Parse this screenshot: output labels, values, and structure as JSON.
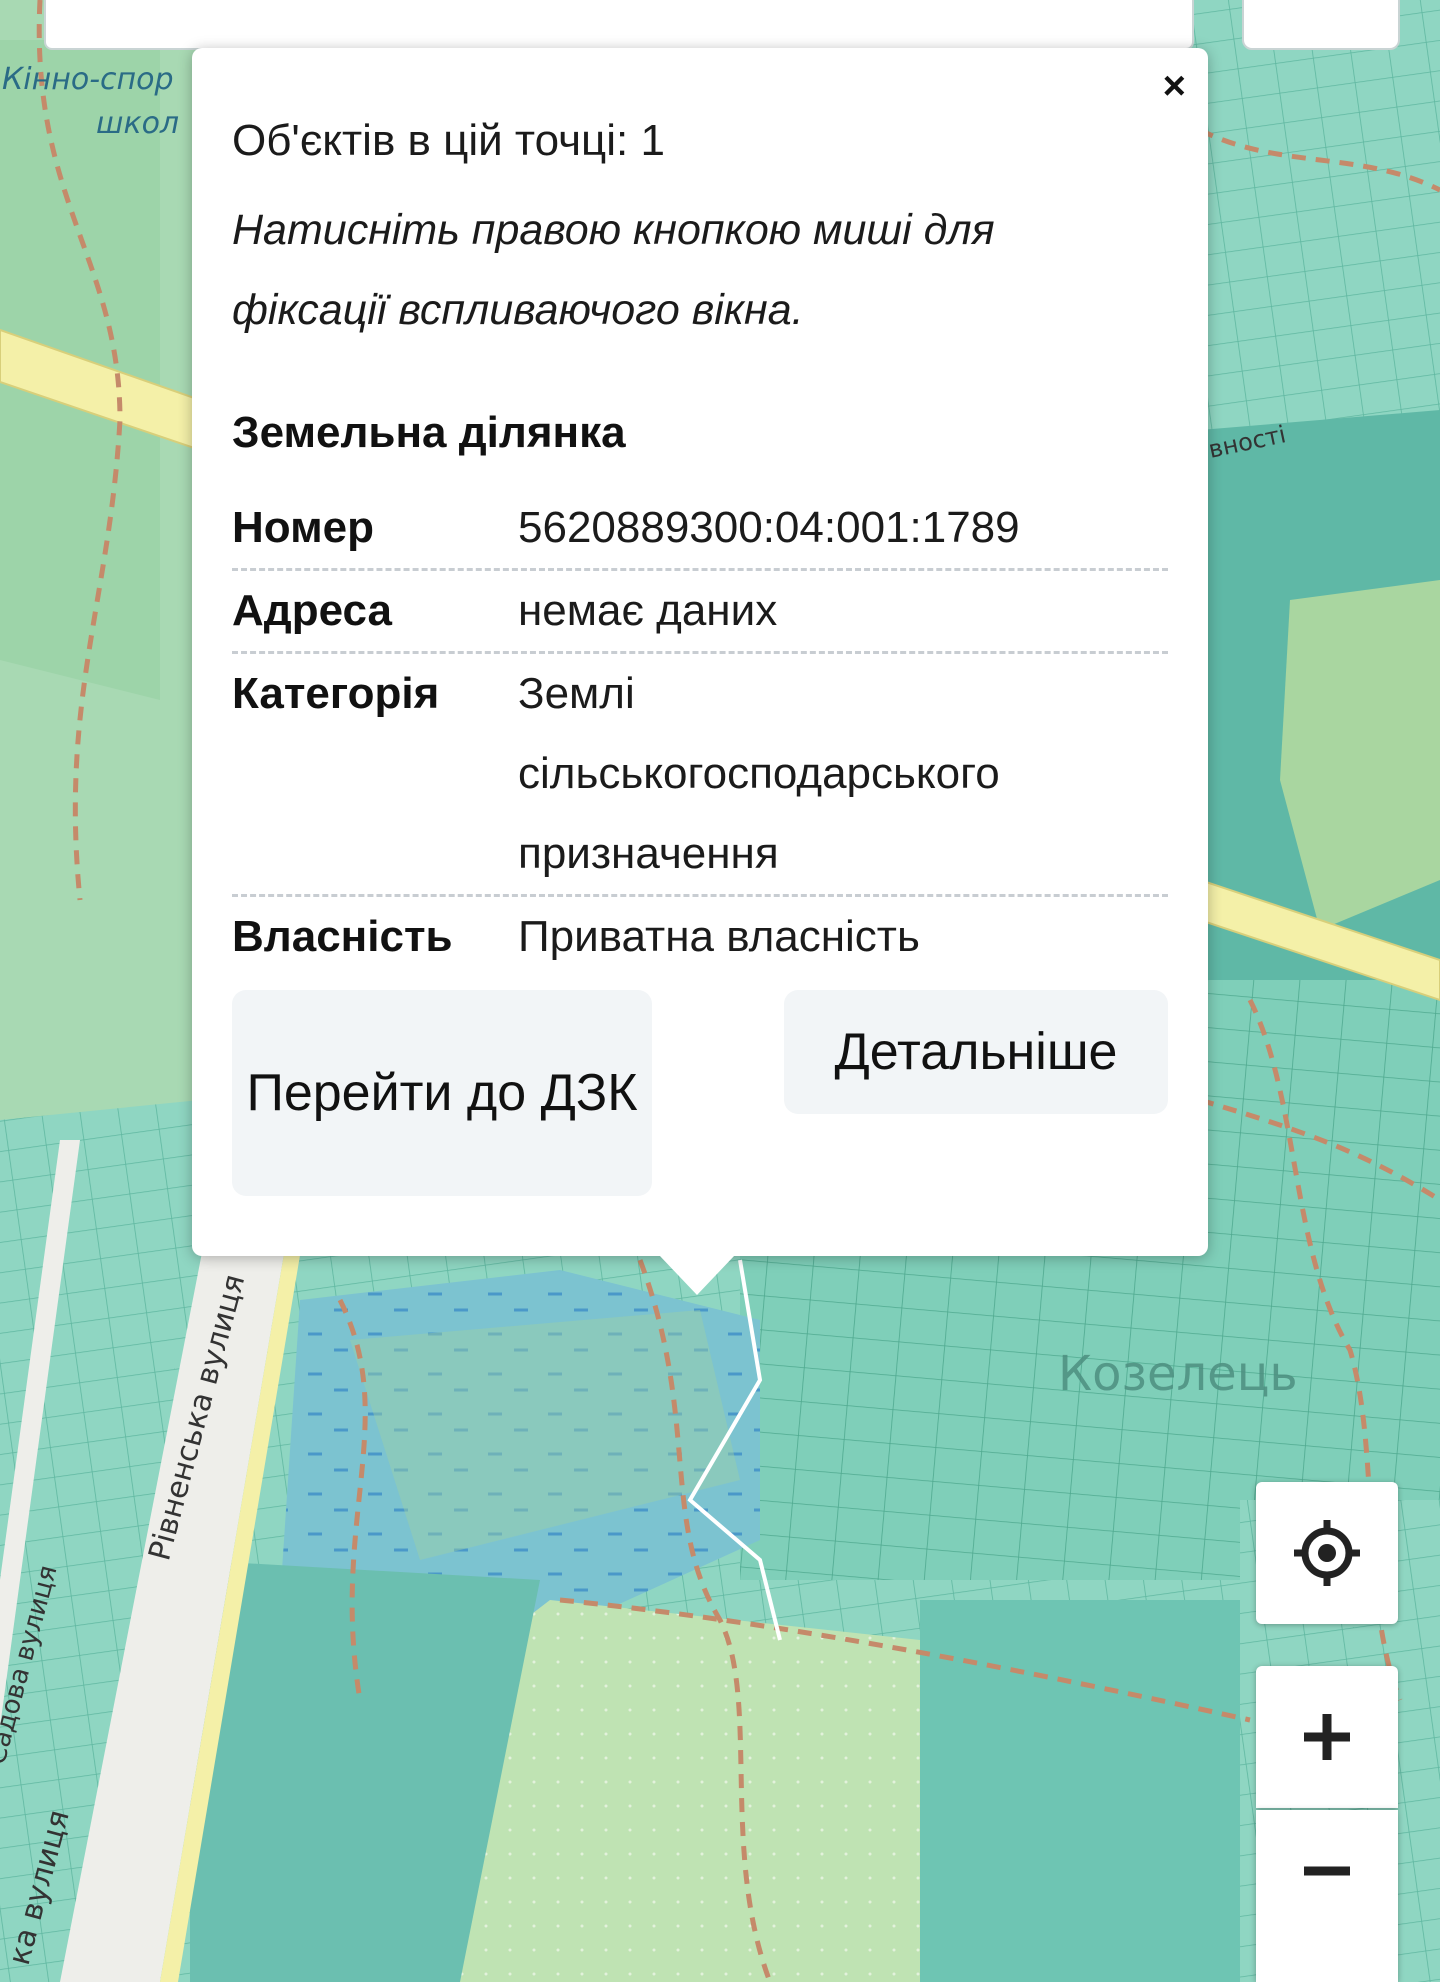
{
  "popup": {
    "close_label": "×",
    "count_text": "Об'єктів в цій точці: 1",
    "hint_text": "Натисніть правою кнопкою миші для фіксації вспливаючого вікна.",
    "section_title": "Земельна ділянка",
    "rows": [
      {
        "key": "Номер",
        "value": "5620889300:04:001:1789"
      },
      {
        "key": "Адреса",
        "value": "немає даних"
      },
      {
        "key": "Категорія",
        "value": "Землі сільськогосподарського призначення"
      },
      {
        "key": "Власність",
        "value": "Приватна власність"
      }
    ],
    "btn_dzk": "Перейти до ДЗК",
    "btn_more": "Детальніше"
  },
  "map": {
    "labels": {
      "school_1": "Кінно-спор",
      "school_2": "школ",
      "street_rivnenska": "Рівненська вулиця",
      "street_sadova": "Садова вулиця",
      "street_bottom": "ка вулиця",
      "street_top_right": "вності",
      "town": "Козелець"
    },
    "colors": {
      "parcel": "#8fd6c2",
      "parcel_line": "#5fb7a0",
      "water": "#86c9d6",
      "forest": "#b4dba6",
      "road": "#f4f0a8",
      "path": "#c58a6a"
    }
  },
  "controls": {
    "locate_icon": "locate-icon",
    "zoom_in_icon": "plus-icon",
    "zoom_out_icon": "minus-icon"
  }
}
